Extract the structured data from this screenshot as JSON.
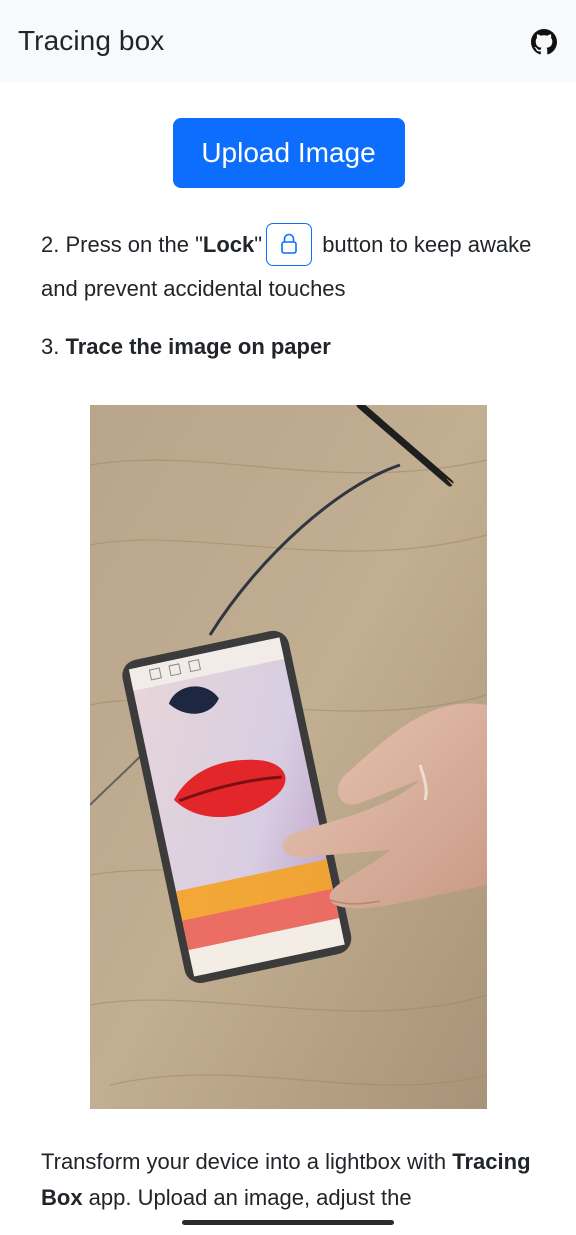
{
  "navbar": {
    "brand": "Tracing box",
    "github_icon": "github-icon"
  },
  "upload": {
    "label": "Upload Image"
  },
  "steps": {
    "step2": {
      "prefix": "2. Press on the \"",
      "bold": "Lock",
      "quote_close": "\"",
      "lock_icon": "lock-icon",
      "suffix": " button to keep awake and prevent accidental touches"
    },
    "step3": {
      "number": "3. ",
      "bold": "Trace the image on paper"
    }
  },
  "photo": {
    "description_icon": "demo-photo"
  },
  "intro": {
    "part1": "Transform your device into a lightbox with ",
    "bold": "Tracing Box",
    "part2": " app. Upload an image, adjust the"
  },
  "colors": {
    "primary": "#0d6efd",
    "navbar_bg": "#f8f9fa",
    "text": "#212529"
  }
}
